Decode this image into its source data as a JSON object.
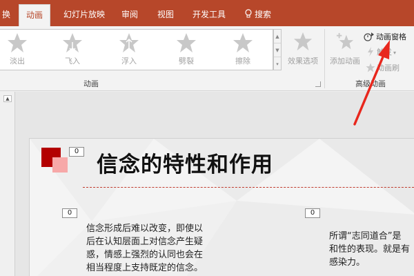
{
  "ribbon_tabs": [
    {
      "label": "换",
      "active": false
    },
    {
      "label": "动画",
      "active": true
    },
    {
      "label": "幻灯片放映",
      "active": false
    },
    {
      "label": "审阅",
      "active": false
    },
    {
      "label": "视图",
      "active": false
    },
    {
      "label": "开发工具",
      "active": false
    },
    {
      "label": "搜索",
      "active": false
    }
  ],
  "gallery": {
    "items": [
      {
        "label": "淡出",
        "icon": "star-fade-icon"
      },
      {
        "label": "飞入",
        "icon": "star-fly-in-icon"
      },
      {
        "label": "浮入",
        "icon": "star-float-in-icon"
      },
      {
        "label": "劈裂",
        "icon": "star-split-icon"
      },
      {
        "label": "擦除",
        "icon": "star-wipe-icon"
      }
    ]
  },
  "effect_options": {
    "label": "效果选项"
  },
  "add_animation": {
    "label": "添加动画"
  },
  "animation_pane": {
    "label": "动画窗格"
  },
  "trigger": {
    "label": "触发"
  },
  "animation_painter": {
    "label": "动画刷"
  },
  "groups": {
    "animation": "动画",
    "advanced": "高级动画"
  },
  "slide": {
    "title": "信念的特性和作用",
    "title_tag": "0",
    "left_tag": "0",
    "right_tag": "0",
    "left_lines": [
      "信念形成后难以改变，即使以",
      "后在认知层面上对信念产生疑",
      "惑，情感上强烈的认同也会在",
      "相当程度上支持既定的信念。"
    ],
    "right_lines": [
      "所谓“志同道合”是",
      "和性的表现。就是有",
      "感染力。"
    ]
  },
  "colors": {
    "accent": "#b7472a",
    "arrow": "#e8271d"
  }
}
